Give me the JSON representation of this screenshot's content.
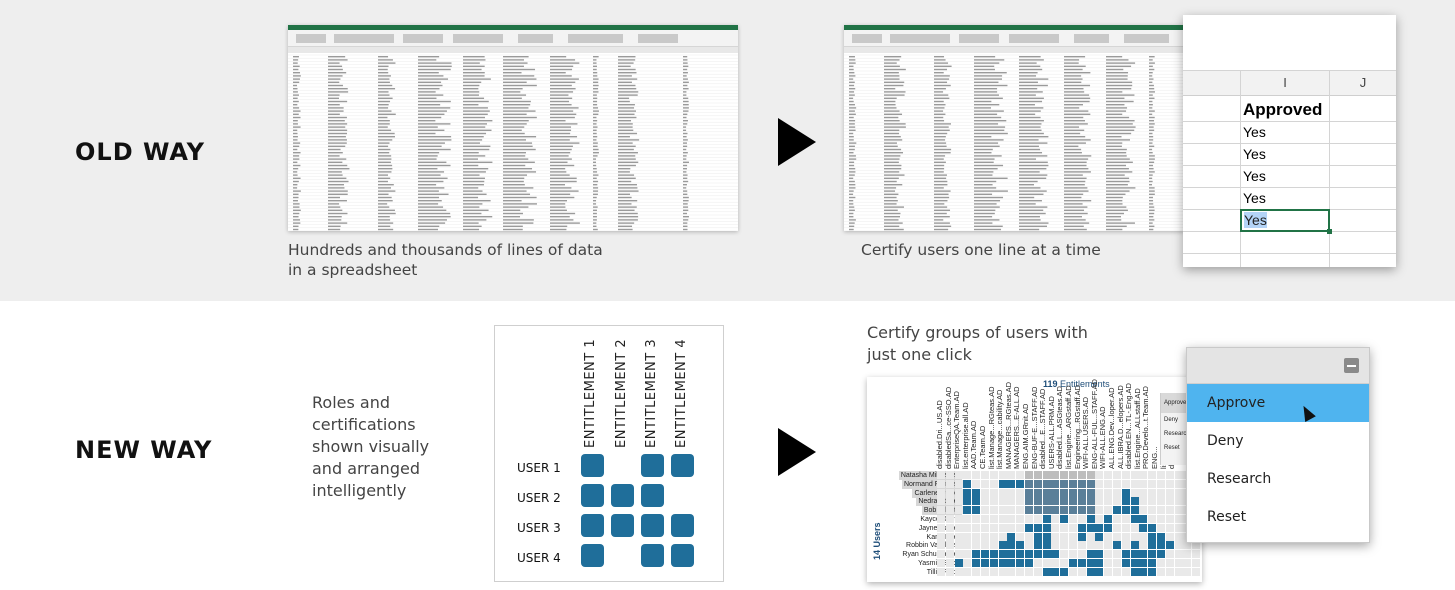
{
  "labels": {
    "old_way": "OLD WAY",
    "new_way": "NEW WAY"
  },
  "old": {
    "caption_left": [
      "Hundreds and thousands of lines of data",
      "in a spreadsheet"
    ],
    "caption_right": "Certify users one line at a time",
    "zoom": {
      "col_i": "I",
      "col_j": "J",
      "header": "Approved",
      "cells": [
        "Yes",
        "Yes",
        "Yes",
        "Yes",
        "Yes"
      ]
    }
  },
  "new": {
    "caption_left": [
      "Roles and",
      "certifications",
      "shown visually",
      "and arranged",
      "intelligently"
    ],
    "caption_right": [
      "Certify groups of users with",
      "just one click"
    ],
    "matrix": {
      "entitlements": [
        "ENTITLEMENT 1",
        "ENTITLEMENT 2",
        "ENTITLEMENT 3",
        "ENTITLEMENT 4"
      ],
      "users": [
        "USER 1",
        "USER 2",
        "USER 3",
        "USER 4"
      ],
      "grid": [
        [
          1,
          0,
          1,
          1
        ],
        [
          1,
          1,
          1,
          0
        ],
        [
          1,
          1,
          1,
          1
        ],
        [
          1,
          0,
          1,
          1
        ]
      ]
    },
    "heatmap": {
      "count": "119",
      "title": "Entitlements",
      "user_count": "14",
      "user_label": "Users",
      "columns": [
        "disabled.Dri...US.AD",
        "disabledSa...ce-SSO.AD",
        "EnterpriseQA.Team.AD",
        "list.enterprise.all.AD",
        "AAD.Team.AD",
        "CE.Team.AD",
        "list.Manage...RGteas.AD",
        "list.Manage...cability.AD",
        "MANAGERS...RGteas.AD",
        "MANAGERS...E-ALL.AD",
        "ENG.AIM.GRnit.AD",
        "ENG-BUF-E...STAFF.AD",
        "disabled...E...STAFF.AD",
        "USERS-ALL.PRM.AD",
        "disabled.L...ASGteas.AD",
        "list.Engine...ARGstaff.AD",
        "Engineering...RGstaff.AD",
        "WIFI-ALL.USERS.AD",
        "ENG-ALL-FUL...STAFF.AD",
        "WIFI-ALL.ENG.AD",
        "ALL.ENG.Dev...loper.AD",
        "ALL.IBRA.D...elopers.AD",
        "disabled.EN...TL-.Eng.AD",
        "list.Engine...ALLstaff.AD",
        "PRO.Develo...t.Team.AD",
        "ENG...",
        "list...",
        "dist..."
      ],
      "rows": [
        "Natasha Mikkelsen",
        "Normand Furness",
        "Carlene Pelosi",
        "Nedra Stuber",
        "Bob Gillette",
        "Kayce Delrio",
        "Jayne Hayter",
        "Karl Haber",
        "Robbin Vandoren",
        "Ryan Schumacher",
        "Yasmin Shick",
        "Tillie Falco"
      ],
      "side_menu": [
        "Approve",
        "Deny",
        "Research",
        "Reset"
      ]
    },
    "menu": {
      "items": [
        "Approve",
        "Deny",
        "Research",
        "Reset"
      ],
      "active": "Approve"
    }
  }
}
